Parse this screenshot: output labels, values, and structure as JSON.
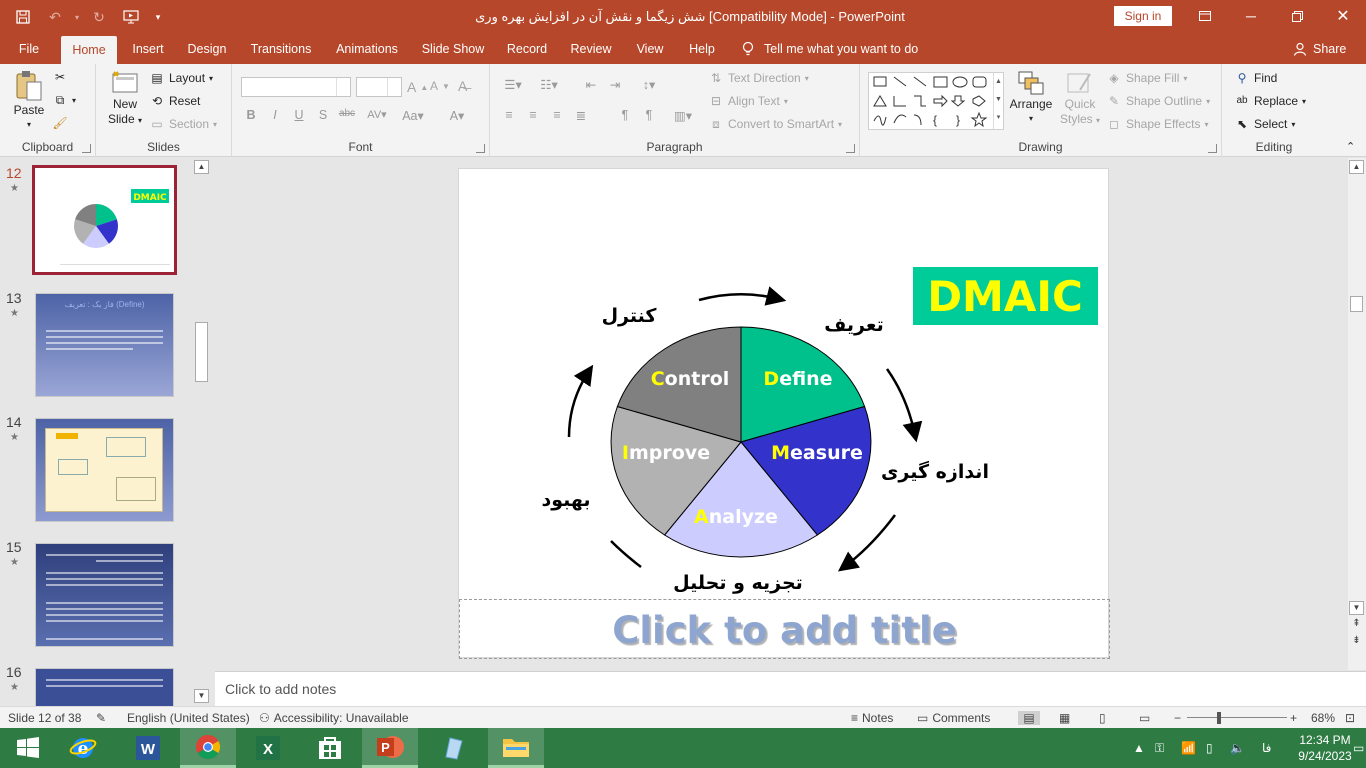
{
  "window": {
    "title": "شش زیگما و نقش آن در افزایش بهره وری [Compatibility Mode]  -  PowerPoint",
    "sign_in": "Sign in"
  },
  "tabs": [
    "File",
    "Home",
    "Insert",
    "Design",
    "Transitions",
    "Animations",
    "Slide Show",
    "Record",
    "Review",
    "View",
    "Help"
  ],
  "active_tab": "Home",
  "tell_me": "Tell me what you want to do",
  "share": "Share",
  "ribbon": {
    "clipboard": {
      "label": "Clipboard",
      "paste": "Paste"
    },
    "slides": {
      "label": "Slides",
      "new_slide_line1": "New",
      "new_slide_line2": "Slide",
      "layout": "Layout",
      "reset": "Reset",
      "section": "Section"
    },
    "font": {
      "label": "Font"
    },
    "paragraph": {
      "label": "Paragraph",
      "text_direction": "Text Direction",
      "align_text": "Align Text",
      "convert_smartart": "Convert to SmartArt"
    },
    "drawing": {
      "label": "Drawing",
      "arrange": "Arrange",
      "quick_styles_line1": "Quick",
      "quick_styles_line2": "Styles",
      "shape_fill": "Shape Fill",
      "shape_outline": "Shape Outline",
      "shape_effects": "Shape Effects"
    },
    "editing": {
      "label": "Editing",
      "find": "Find",
      "replace": "Replace",
      "select": "Select"
    }
  },
  "thumbnails": [
    {
      "num": "12",
      "selected": true,
      "badge": "DMAIC"
    },
    {
      "num": "13",
      "selected": false,
      "heading": "فاز یک : تعریف (Define)"
    },
    {
      "num": "14",
      "selected": false
    },
    {
      "num": "15",
      "selected": false
    },
    {
      "num": "16",
      "selected": false
    }
  ],
  "slide": {
    "badge": "DMAIC",
    "badge_color": "#00cc99",
    "segments": [
      {
        "initial": "C",
        "rest": "ontrol",
        "color": "#808080"
      },
      {
        "initial": "D",
        "rest": "efine",
        "color": "#00c08b"
      },
      {
        "initial": "M",
        "rest": "easure",
        "color": "#3333cc"
      },
      {
        "initial": "A",
        "rest": "nalyze",
        "color": "#ccccff"
      },
      {
        "initial": "I",
        "rest": "mprove",
        "color": "#b2b2b2"
      }
    ],
    "initial_color": "#ffff00",
    "persian_labels": {
      "control": "کنترل",
      "define": "تعریف",
      "measure": "اندازه گیری",
      "analyze": "تجزیه و تحلیل",
      "improve": "بهبود"
    },
    "title_placeholder": "Click to add title"
  },
  "notes_placeholder": "Click to add notes",
  "status": {
    "slide_counter": "Slide 12 of 38",
    "language": "English (United States)",
    "accessibility": "Accessibility: Unavailable",
    "notes": "Notes",
    "comments": "Comments",
    "zoom": "68%"
  },
  "taskbar": {
    "lang": "فا",
    "time": "12:34 PM",
    "date": "9/24/2023"
  }
}
